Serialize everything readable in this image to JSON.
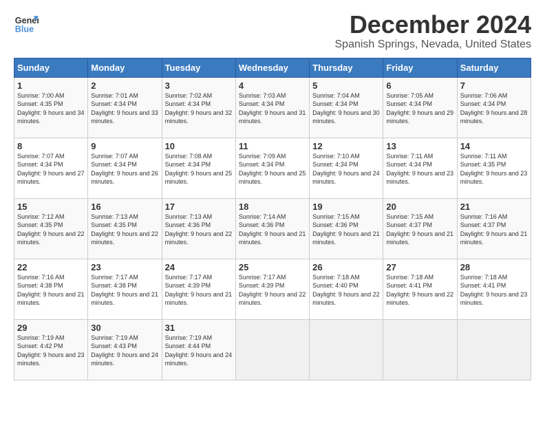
{
  "logo": {
    "general": "General",
    "blue": "Blue"
  },
  "title": "December 2024",
  "subtitle": "Spanish Springs, Nevada, United States",
  "headers": [
    "Sunday",
    "Monday",
    "Tuesday",
    "Wednesday",
    "Thursday",
    "Friday",
    "Saturday"
  ],
  "weeks": [
    [
      {
        "day": "1",
        "sunrise": "Sunrise: 7:00 AM",
        "sunset": "Sunset: 4:35 PM",
        "daylight": "Daylight: 9 hours and 34 minutes."
      },
      {
        "day": "2",
        "sunrise": "Sunrise: 7:01 AM",
        "sunset": "Sunset: 4:34 PM",
        "daylight": "Daylight: 9 hours and 33 minutes."
      },
      {
        "day": "3",
        "sunrise": "Sunrise: 7:02 AM",
        "sunset": "Sunset: 4:34 PM",
        "daylight": "Daylight: 9 hours and 32 minutes."
      },
      {
        "day": "4",
        "sunrise": "Sunrise: 7:03 AM",
        "sunset": "Sunset: 4:34 PM",
        "daylight": "Daylight: 9 hours and 31 minutes."
      },
      {
        "day": "5",
        "sunrise": "Sunrise: 7:04 AM",
        "sunset": "Sunset: 4:34 PM",
        "daylight": "Daylight: 9 hours and 30 minutes."
      },
      {
        "day": "6",
        "sunrise": "Sunrise: 7:05 AM",
        "sunset": "Sunset: 4:34 PM",
        "daylight": "Daylight: 9 hours and 29 minutes."
      },
      {
        "day": "7",
        "sunrise": "Sunrise: 7:06 AM",
        "sunset": "Sunset: 4:34 PM",
        "daylight": "Daylight: 9 hours and 28 minutes."
      }
    ],
    [
      {
        "day": "8",
        "sunrise": "Sunrise: 7:07 AM",
        "sunset": "Sunset: 4:34 PM",
        "daylight": "Daylight: 9 hours and 27 minutes."
      },
      {
        "day": "9",
        "sunrise": "Sunrise: 7:07 AM",
        "sunset": "Sunset: 4:34 PM",
        "daylight": "Daylight: 9 hours and 26 minutes."
      },
      {
        "day": "10",
        "sunrise": "Sunrise: 7:08 AM",
        "sunset": "Sunset: 4:34 PM",
        "daylight": "Daylight: 9 hours and 25 minutes."
      },
      {
        "day": "11",
        "sunrise": "Sunrise: 7:09 AM",
        "sunset": "Sunset: 4:34 PM",
        "daylight": "Daylight: 9 hours and 25 minutes."
      },
      {
        "day": "12",
        "sunrise": "Sunrise: 7:10 AM",
        "sunset": "Sunset: 4:34 PM",
        "daylight": "Daylight: 9 hours and 24 minutes."
      },
      {
        "day": "13",
        "sunrise": "Sunrise: 7:11 AM",
        "sunset": "Sunset: 4:34 PM",
        "daylight": "Daylight: 9 hours and 23 minutes."
      },
      {
        "day": "14",
        "sunrise": "Sunrise: 7:11 AM",
        "sunset": "Sunset: 4:35 PM",
        "daylight": "Daylight: 9 hours and 23 minutes."
      }
    ],
    [
      {
        "day": "15",
        "sunrise": "Sunrise: 7:12 AM",
        "sunset": "Sunset: 4:35 PM",
        "daylight": "Daylight: 9 hours and 22 minutes."
      },
      {
        "day": "16",
        "sunrise": "Sunrise: 7:13 AM",
        "sunset": "Sunset: 4:35 PM",
        "daylight": "Daylight: 9 hours and 22 minutes."
      },
      {
        "day": "17",
        "sunrise": "Sunrise: 7:13 AM",
        "sunset": "Sunset: 4:36 PM",
        "daylight": "Daylight: 9 hours and 22 minutes."
      },
      {
        "day": "18",
        "sunrise": "Sunrise: 7:14 AM",
        "sunset": "Sunset: 4:36 PM",
        "daylight": "Daylight: 9 hours and 21 minutes."
      },
      {
        "day": "19",
        "sunrise": "Sunrise: 7:15 AM",
        "sunset": "Sunset: 4:36 PM",
        "daylight": "Daylight: 9 hours and 21 minutes."
      },
      {
        "day": "20",
        "sunrise": "Sunrise: 7:15 AM",
        "sunset": "Sunset: 4:37 PM",
        "daylight": "Daylight: 9 hours and 21 minutes."
      },
      {
        "day": "21",
        "sunrise": "Sunrise: 7:16 AM",
        "sunset": "Sunset: 4:37 PM",
        "daylight": "Daylight: 9 hours and 21 minutes."
      }
    ],
    [
      {
        "day": "22",
        "sunrise": "Sunrise: 7:16 AM",
        "sunset": "Sunset: 4:38 PM",
        "daylight": "Daylight: 9 hours and 21 minutes."
      },
      {
        "day": "23",
        "sunrise": "Sunrise: 7:17 AM",
        "sunset": "Sunset: 4:38 PM",
        "daylight": "Daylight: 9 hours and 21 minutes."
      },
      {
        "day": "24",
        "sunrise": "Sunrise: 7:17 AM",
        "sunset": "Sunset: 4:39 PM",
        "daylight": "Daylight: 9 hours and 21 minutes."
      },
      {
        "day": "25",
        "sunrise": "Sunrise: 7:17 AM",
        "sunset": "Sunset: 4:39 PM",
        "daylight": "Daylight: 9 hours and 22 minutes."
      },
      {
        "day": "26",
        "sunrise": "Sunrise: 7:18 AM",
        "sunset": "Sunset: 4:40 PM",
        "daylight": "Daylight: 9 hours and 22 minutes."
      },
      {
        "day": "27",
        "sunrise": "Sunrise: 7:18 AM",
        "sunset": "Sunset: 4:41 PM",
        "daylight": "Daylight: 9 hours and 22 minutes."
      },
      {
        "day": "28",
        "sunrise": "Sunrise: 7:18 AM",
        "sunset": "Sunset: 4:41 PM",
        "daylight": "Daylight: 9 hours and 23 minutes."
      }
    ],
    [
      {
        "day": "29",
        "sunrise": "Sunrise: 7:19 AM",
        "sunset": "Sunset: 4:42 PM",
        "daylight": "Daylight: 9 hours and 23 minutes."
      },
      {
        "day": "30",
        "sunrise": "Sunrise: 7:19 AM",
        "sunset": "Sunset: 4:43 PM",
        "daylight": "Daylight: 9 hours and 24 minutes."
      },
      {
        "day": "31",
        "sunrise": "Sunrise: 7:19 AM",
        "sunset": "Sunset: 4:44 PM",
        "daylight": "Daylight: 9 hours and 24 minutes."
      },
      null,
      null,
      null,
      null
    ]
  ]
}
